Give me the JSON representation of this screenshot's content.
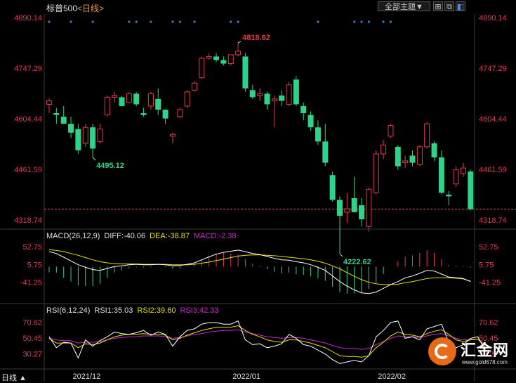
{
  "header": {
    "instrument": "标普500",
    "timeframe": "<日线>",
    "theme_button": "全部主题▼",
    "icons": [
      "grid-icon",
      "restore-icon",
      "toggle-icon"
    ]
  },
  "period_label": "日线 ▲",
  "chart_data": [
    {
      "type": "candlestick",
      "title": "标普500",
      "y_ticks": [
        "4890.14",
        "4747.29",
        "4604.44",
        "4461.59",
        "4318.74"
      ],
      "ylim": [
        4292.5,
        4896
      ],
      "x_labels": [
        "2021/12",
        "2022/01",
        "2022/02"
      ],
      "x_label_indices": [
        4,
        26,
        46
      ],
      "annotations": [
        {
          "label": "4818.62",
          "index": 26,
          "value": 4818.62,
          "kind": "high"
        },
        {
          "label": "4495.12",
          "index": 6,
          "value": 4495.12,
          "kind": "low"
        },
        {
          "label": "4222.62",
          "index": 40,
          "value": 4222.62,
          "kind": "low"
        }
      ],
      "last_price": 4348.87,
      "candles": [
        {
          "o": 4645,
          "h": 4662,
          "l": 4620,
          "c": 4655
        },
        {
          "o": 4620,
          "h": 4635,
          "l": 4590,
          "c": 4615
        },
        {
          "o": 4610,
          "h": 4640,
          "l": 4590,
          "c": 4590
        },
        {
          "o": 4590,
          "h": 4610,
          "l": 4550,
          "c": 4565
        },
        {
          "o": 4575,
          "h": 4590,
          "l": 4505,
          "c": 4515
        },
        {
          "o": 4535,
          "h": 4590,
          "l": 4525,
          "c": 4580
        },
        {
          "o": 4580,
          "h": 4590,
          "l": 4495.12,
          "c": 4520
        },
        {
          "o": 4540,
          "h": 4590,
          "l": 4535,
          "c": 4575
        },
        {
          "o": 4615,
          "h": 4670,
          "l": 4610,
          "c": 4665
        },
        {
          "o": 4665,
          "h": 4680,
          "l": 4650,
          "c": 4670
        },
        {
          "o": 4665,
          "h": 4670,
          "l": 4640,
          "c": 4640
        },
        {
          "o": 4650,
          "h": 4680,
          "l": 4650,
          "c": 4675
        },
        {
          "o": 4675,
          "h": 4680,
          "l": 4640,
          "c": 4645
        },
        {
          "o": 4620,
          "h": 4635,
          "l": 4610,
          "c": 4615
        },
        {
          "o": 4640,
          "h": 4680,
          "l": 4630,
          "c": 4675
        },
        {
          "o": 4660,
          "h": 4690,
          "l": 4615,
          "c": 4630
        },
        {
          "o": 4630,
          "h": 4630,
          "l": 4590,
          "c": 4605
        },
        {
          "o": 4555,
          "h": 4565,
          "l": 4535,
          "c": 4560
        },
        {
          "o": 4610,
          "h": 4635,
          "l": 4605,
          "c": 4630
        },
        {
          "o": 4640,
          "h": 4685,
          "l": 4635,
          "c": 4680
        },
        {
          "o": 4685,
          "h": 4710,
          "l": 4680,
          "c": 4705
        },
        {
          "o": 4720,
          "h": 4780,
          "l": 4715,
          "c": 4775
        },
        {
          "o": 4775,
          "h": 4790,
          "l": 4770,
          "c": 4780
        },
        {
          "o": 4780,
          "h": 4790,
          "l": 4765,
          "c": 4770
        },
        {
          "o": 4770,
          "h": 4780,
          "l": 4755,
          "c": 4760
        },
        {
          "o": 4760,
          "h": 4785,
          "l": 4755,
          "c": 4785
        },
        {
          "o": 4785,
          "h": 4818.62,
          "l": 4780,
          "c": 4795
        },
        {
          "o": 4780,
          "h": 4790,
          "l": 4680,
          "c": 4690
        },
        {
          "o": 4685,
          "h": 4700,
          "l": 4660,
          "c": 4665
        },
        {
          "o": 4670,
          "h": 4690,
          "l": 4655,
          "c": 4675
        },
        {
          "o": 4675,
          "h": 4680,
          "l": 4630,
          "c": 4645
        },
        {
          "o": 4655,
          "h": 4670,
          "l": 4580,
          "c": 4660
        },
        {
          "o": 4670,
          "h": 4685,
          "l": 4640,
          "c": 4655
        },
        {
          "o": 4645,
          "h": 4710,
          "l": 4640,
          "c": 4700
        },
        {
          "o": 4715,
          "h": 4725,
          "l": 4640,
          "c": 4645
        },
        {
          "o": 4640,
          "h": 4650,
          "l": 4600,
          "c": 4620
        },
        {
          "o": 4615,
          "h": 4625,
          "l": 4570,
          "c": 4580
        },
        {
          "o": 4580,
          "h": 4600,
          "l": 4530,
          "c": 4540
        },
        {
          "o": 4540,
          "h": 4590,
          "l": 4470,
          "c": 4480
        },
        {
          "o": 4445,
          "h": 4455,
          "l": 4370,
          "c": 4375
        },
        {
          "o": 4375,
          "h": 4385,
          "l": 4222.62,
          "c": 4330
        },
        {
          "o": 4340,
          "h": 4395,
          "l": 4310,
          "c": 4350
        },
        {
          "o": 4380,
          "h": 4440,
          "l": 4355,
          "c": 4340
        },
        {
          "o": 4360,
          "h": 4380,
          "l": 4300,
          "c": 4320
        },
        {
          "o": 4300,
          "h": 4410,
          "l": 4285,
          "c": 4405
        },
        {
          "o": 4395,
          "h": 4515,
          "l": 4390,
          "c": 4505
        },
        {
          "o": 4505,
          "h": 4545,
          "l": 4490,
          "c": 4530
        },
        {
          "o": 4555,
          "h": 4590,
          "l": 4550,
          "c": 4585
        },
        {
          "o": 4525,
          "h": 4530,
          "l": 4460,
          "c": 4470
        },
        {
          "o": 4480,
          "h": 4500,
          "l": 4465,
          "c": 4485
        },
        {
          "o": 4500,
          "h": 4515,
          "l": 4470,
          "c": 4480
        },
        {
          "o": 4475,
          "h": 4530,
          "l": 4470,
          "c": 4525
        },
        {
          "o": 4525,
          "h": 4595,
          "l": 4520,
          "c": 4590
        },
        {
          "o": 4535,
          "h": 4540,
          "l": 4485,
          "c": 4495
        },
        {
          "o": 4495,
          "h": 4515,
          "l": 4390,
          "c": 4395
        },
        {
          "o": 4390,
          "h": 4400,
          "l": 4360,
          "c": 4385
        },
        {
          "o": 4420,
          "h": 4470,
          "l": 4410,
          "c": 4460
        },
        {
          "o": 4450,
          "h": 4480,
          "l": 4440,
          "c": 4465
        },
        {
          "o": 4455,
          "h": 4460,
          "l": 4345,
          "c": 4348.87
        }
      ]
    },
    {
      "type": "macd",
      "params": "MACD(26,12,9)",
      "legend": [
        {
          "text": "DIFF:-40.06",
          "color": "#e0e0e0"
        },
        {
          "text": "DEA:-38.87",
          "color": "#e8e000"
        },
        {
          "text": "MACD:-2.38",
          "color": "#d028d0"
        }
      ],
      "y_ticks": [
        "52.75",
        "5.75",
        "-41.25"
      ],
      "ylim": [
        -95,
        70
      ],
      "diff": [
        40,
        35,
        25,
        15,
        5,
        -2,
        -8,
        -10,
        -5,
        0,
        2,
        5,
        6,
        5,
        5,
        6,
        5,
        2,
        3,
        6,
        10,
        18,
        26,
        33,
        38,
        41,
        44,
        40,
        35,
        32,
        27,
        22,
        18,
        17,
        13,
        10,
        5,
        -2,
        -10,
        -25,
        -40,
        -52,
        -62,
        -70,
        -72,
        -68,
        -58,
        -48,
        -40,
        -30,
        -25,
        -18,
        -10,
        -12,
        -20,
        -28,
        -30,
        -32,
        -40.06
      ],
      "dea": [
        45,
        43,
        40,
        35,
        30,
        24,
        18,
        13,
        10,
        8,
        7,
        7,
        7,
        6,
        6,
        6,
        6,
        5,
        5,
        5,
        6,
        9,
        12,
        16,
        20,
        24,
        28,
        30,
        31,
        31,
        30,
        29,
        27,
        25,
        23,
        21,
        18,
        14,
        9,
        2,
        -6,
        -16,
        -26,
        -35,
        -42,
        -46,
        -48,
        -48,
        -47,
        -43,
        -40,
        -36,
        -32,
        -30,
        -30,
        -30,
        -31,
        -33,
        -38.87
      ],
      "hist": [
        -15,
        -16,
        -30,
        -40,
        -50,
        -52,
        -52,
        -46,
        -30,
        -16,
        -10,
        -4,
        -2,
        -2,
        -2,
        0,
        -2,
        -6,
        -4,
        2,
        8,
        18,
        28,
        34,
        36,
        34,
        32,
        20,
        8,
        2,
        -6,
        -14,
        -18,
        -16,
        -20,
        -22,
        -26,
        -32,
        -38,
        -54,
        -68,
        -72,
        -72,
        -70,
        -60,
        -44,
        -20,
        0,
        14,
        26,
        30,
        36,
        44,
        36,
        20,
        4,
        2,
        2,
        -2.38
      ]
    },
    {
      "type": "rsi",
      "params": "RSI(6,12,24)",
      "legend": [
        {
          "text": "RSI1:35.03",
          "color": "#e0e0e0"
        },
        {
          "text": "RSI2:39.60",
          "color": "#e8e000"
        },
        {
          "text": "RSI3:42.33",
          "color": "#d028d0"
        }
      ],
      "y_ticks": [
        "70.62",
        "50.45",
        "30.27"
      ],
      "ylim": [
        12,
        78
      ],
      "rsi1": [
        52,
        38,
        45,
        44,
        25,
        48,
        40,
        47,
        52,
        58,
        56,
        55,
        57,
        60,
        54,
        58,
        55,
        40,
        52,
        60,
        62,
        68,
        70,
        70,
        68,
        68,
        72,
        48,
        42,
        43,
        38,
        40,
        43,
        55,
        50,
        42,
        40,
        35,
        30,
        23,
        18,
        20,
        22,
        20,
        28,
        52,
        60,
        70,
        72,
        50,
        52,
        48,
        62,
        65,
        68,
        45,
        38,
        42,
        50,
        52,
        35.03
      ],
      "rsi2": [
        50,
        44,
        44,
        44,
        38,
        43,
        42,
        44,
        48,
        52,
        54,
        55,
        55,
        56,
        55,
        55,
        54,
        48,
        50,
        54,
        57,
        60,
        62,
        64,
        64,
        64,
        66,
        60,
        55,
        52,
        48,
        46,
        45,
        48,
        48,
        46,
        44,
        41,
        38,
        33,
        28,
        27,
        27,
        26,
        28,
        38,
        45,
        53,
        58,
        55,
        54,
        52,
        56,
        59,
        61,
        55,
        48,
        46,
        48,
        49,
        39.6
      ],
      "rsi3": [
        50,
        48,
        47,
        47,
        44,
        45,
        45,
        46,
        48,
        50,
        51,
        52,
        52,
        53,
        53,
        53,
        52,
        50,
        51,
        53,
        55,
        56,
        58,
        59,
        60,
        60,
        61,
        58,
        56,
        54,
        52,
        51,
        50,
        51,
        51,
        50,
        48,
        46,
        44,
        41,
        38,
        37,
        37,
        36,
        37,
        42,
        46,
        50,
        53,
        52,
        52,
        51,
        53,
        55,
        56,
        53,
        50,
        48,
        49,
        49,
        42.33
      ]
    }
  ],
  "logo": {
    "brand": "汇金网",
    "site": "www.gold678.com"
  },
  "colors": {
    "up": "#e8384f",
    "down": "#2ed38a",
    "axis_text": "#e8384f",
    "grid": "#3a3a3a",
    "dot": "#3a8ee6",
    "last_line": "#e8603a"
  }
}
